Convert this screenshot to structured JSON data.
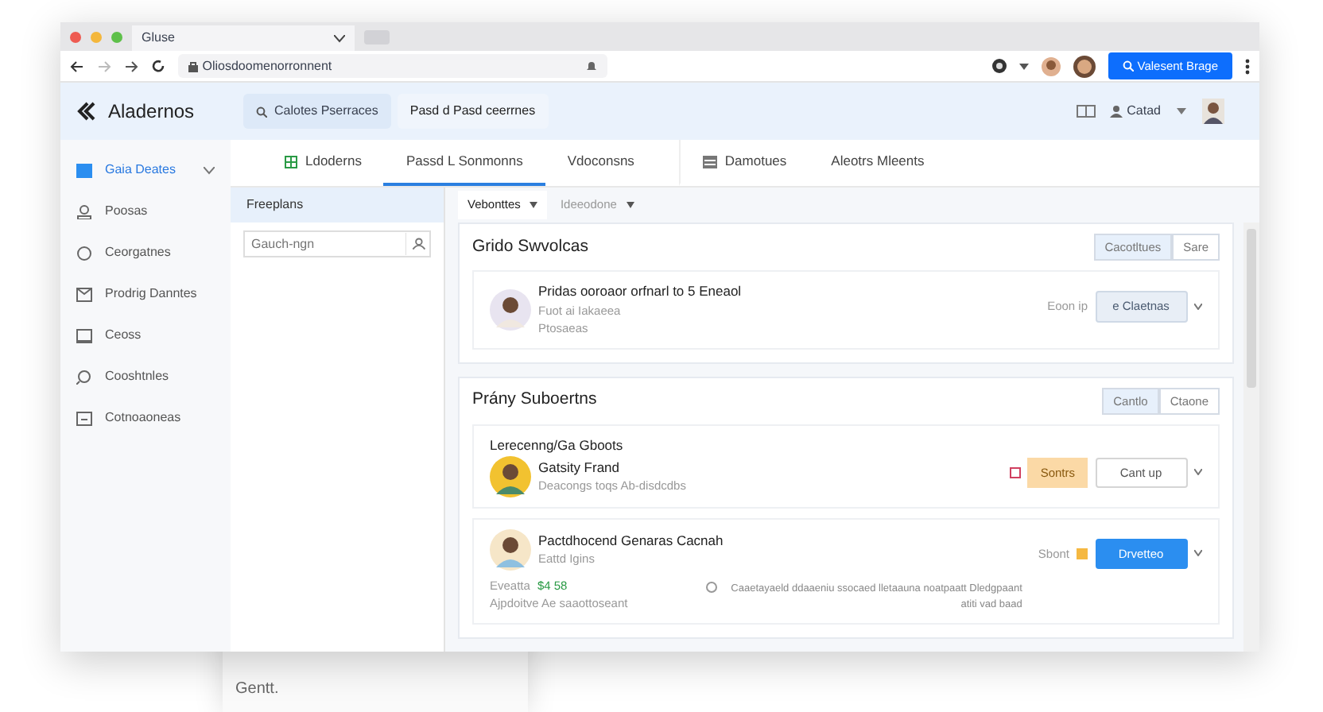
{
  "browser": {
    "tab_title": "Gluse",
    "url": "Oliosdoomenorronnent",
    "action_button": "Valesent Brage"
  },
  "app": {
    "name": "Aladernos",
    "search_chip": "Calotes Pserraces",
    "filter_chip": "Pasd d Pasd ceerrnes",
    "user_label": "Catad"
  },
  "sidebar": [
    {
      "label": "Gaia Deates",
      "selected": true
    },
    {
      "label": "Poosas",
      "selected": false
    },
    {
      "label": "Ceorgatnes",
      "selected": false
    },
    {
      "label": "Prodrig Danntes",
      "selected": false
    },
    {
      "label": "Ceoss",
      "selected": false
    },
    {
      "label": "Cooshtnles",
      "selected": false
    },
    {
      "label": "Cotnoaoneas",
      "selected": false
    }
  ],
  "nav_tabs": [
    {
      "label": "Ldoderns",
      "selected": false
    },
    {
      "label": "Passd L Sonmonns",
      "selected": true
    },
    {
      "label": "Vdoconsns",
      "selected": false
    },
    {
      "label": "Damotues",
      "selected": false
    },
    {
      "label": "Aleotrs Mleents",
      "selected": false
    }
  ],
  "list_panel": {
    "header": "Freeplans",
    "search": {
      "placeholder": "Gauch-ngn"
    }
  },
  "sub_tabs": [
    {
      "label": "Vebonttes",
      "selected": true
    },
    {
      "label": "Ideeodone",
      "selected": false
    }
  ],
  "sections": [
    {
      "title": "Grido Swvolcas",
      "buttons": [
        {
          "label": "Cacotltues",
          "selected": true
        },
        {
          "label": "Sare",
          "selected": false
        }
      ],
      "items": [
        {
          "title": "Pridas ooroaor orfnarl to 5 Eneaol",
          "subtitle": "Fuot ai Iakaeea",
          "meta": "Ptosaeas",
          "side_text": "Eoon ip",
          "action": {
            "label": "e Claetnas",
            "kind": "secondary"
          }
        }
      ]
    },
    {
      "title": "Prány Suboertns",
      "buttons": [
        {
          "label": "Cantlo",
          "selected": true
        },
        {
          "label": "Ctaone",
          "selected": false
        }
      ],
      "items": [
        {
          "label": "Lerecenng/Ga Gboots",
          "title": "Gatsity Frand",
          "subtitle": "Deacongs toqs Ab-disdcdbs",
          "badge": "Sontrs",
          "action": {
            "label": "Cant up",
            "kind": "outline"
          }
        },
        {
          "title": "Pactdhocend Genaras Cacnah",
          "subtitle": "Eattd Igins",
          "side_text": "Sbont",
          "action": {
            "label": "Drvetteo",
            "kind": "primary"
          },
          "footer": {
            "label": "Eveatta",
            "amount": "$4 58",
            "note": "Ajpdoitve Ae saaottoseant",
            "info": "Caaetayaeld ddaaeniu ssocaed lletaauna noatpaatt Dledgpaant atiti vad baad"
          }
        }
      ]
    }
  ],
  "behind_window": {
    "label": "Gentt."
  }
}
